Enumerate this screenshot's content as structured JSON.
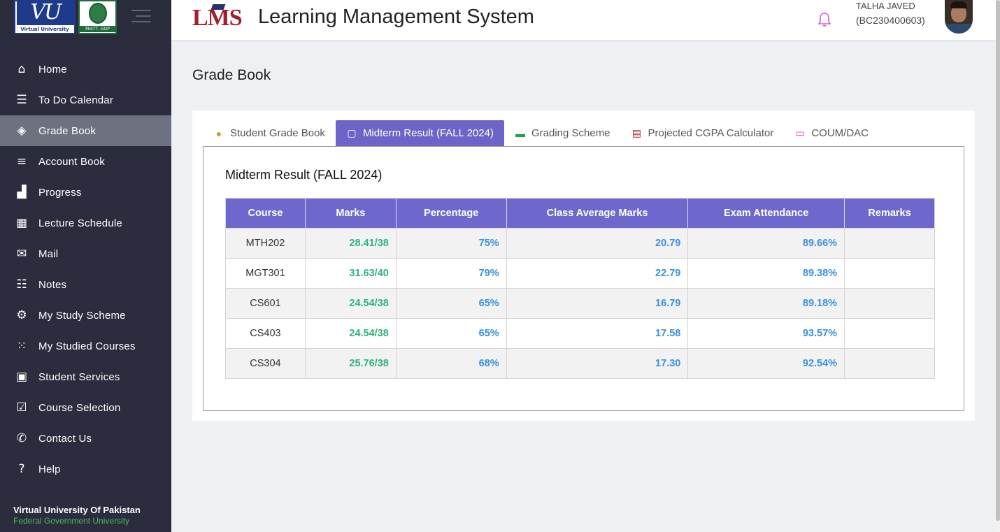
{
  "sidebar": {
    "logo_text": "Virtual University",
    "gop_text": "MoITT, GOP",
    "items": [
      {
        "label": "Home",
        "icon": "home-icon"
      },
      {
        "label": "To Do Calendar",
        "icon": "list-icon"
      },
      {
        "label": "Grade Book",
        "icon": "layers-icon"
      },
      {
        "label": "Account Book",
        "icon": "sliders-icon"
      },
      {
        "label": "Progress",
        "icon": "chart-icon"
      },
      {
        "label": "Lecture Schedule",
        "icon": "calendar-icon"
      },
      {
        "label": "Mail",
        "icon": "mail-icon"
      },
      {
        "label": "Notes",
        "icon": "checklist-icon"
      },
      {
        "label": "My Study Scheme",
        "icon": "gear-icon"
      },
      {
        "label": "My Studied Courses",
        "icon": "grid-icon"
      },
      {
        "label": "Student Services",
        "icon": "bag-icon"
      },
      {
        "label": "Course Selection",
        "icon": "calendar-check-icon"
      },
      {
        "label": "Contact Us",
        "icon": "phone-icon"
      },
      {
        "label": "Help",
        "icon": "question-icon"
      }
    ],
    "active_index": 2,
    "footer": {
      "title": "Virtual University Of Pakistan",
      "subtitle": "Federal Government University"
    }
  },
  "header": {
    "logo": "LMS",
    "title": "Learning Management System",
    "user_name": "TALHA JAVED",
    "user_id": "(BC230400603)"
  },
  "page": {
    "title": "Grade Book"
  },
  "tabs": [
    {
      "label": "Student Grade Book",
      "icon": "user-icon",
      "color": "#c9a227"
    },
    {
      "label": "Midterm Result (FALL 2024)",
      "icon": "clipboard-icon",
      "color": "#ffffff"
    },
    {
      "label": "Grading Scheme",
      "icon": "book-icon",
      "color": "#1aa34a"
    },
    {
      "label": "Projected CGPA Calculator",
      "icon": "calculator-icon",
      "color": "#a1202a"
    },
    {
      "label": "COUM/DAC",
      "icon": "id-card-icon",
      "color": "#d63fd0"
    }
  ],
  "active_tab": 1,
  "result": {
    "title": "Midterm Result (FALL 2024)",
    "columns": [
      "Course",
      "Marks",
      "Percentage",
      "Class Average Marks",
      "Exam Attendance",
      "Remarks"
    ],
    "rows": [
      {
        "course": "MTH202",
        "marks": "28.41/38",
        "percentage": "75%",
        "class_avg": "20.79",
        "attendance": "89.66%",
        "remarks": ""
      },
      {
        "course": "MGT301",
        "marks": "31.63/40",
        "percentage": "79%",
        "class_avg": "22.79",
        "attendance": "89.38%",
        "remarks": ""
      },
      {
        "course": "CS601",
        "marks": "24.54/38",
        "percentage": "65%",
        "class_avg": "16.79",
        "attendance": "89.18%",
        "remarks": ""
      },
      {
        "course": "CS403",
        "marks": "24.54/38",
        "percentage": "65%",
        "class_avg": "17.58",
        "attendance": "93.57%",
        "remarks": ""
      },
      {
        "course": "CS304",
        "marks": "25.76/38",
        "percentage": "68%",
        "class_avg": "17.30",
        "attendance": "92.54%",
        "remarks": ""
      }
    ]
  },
  "colors": {
    "sidebar_bg": "#2b2d3f",
    "accent": "#6e63c7",
    "marks_green": "#2fb37f",
    "value_blue": "#3a8fe0"
  }
}
